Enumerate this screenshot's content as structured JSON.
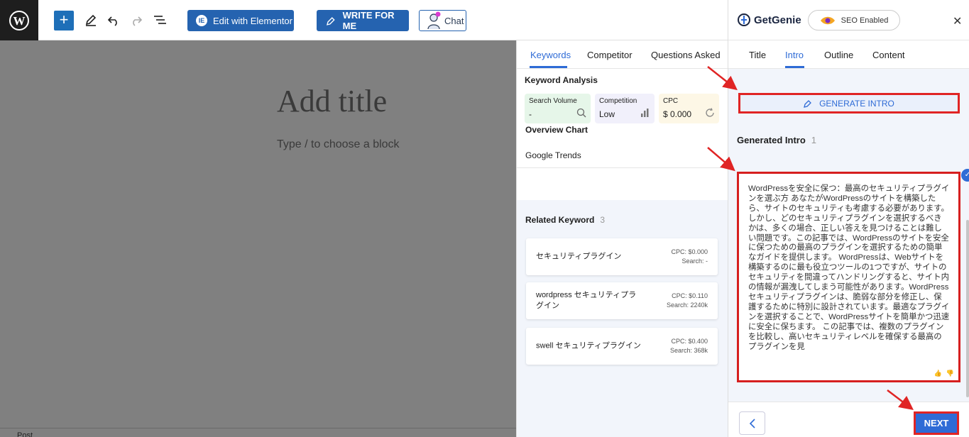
{
  "toolbar": {
    "elementor_label": "Edit with Elementor",
    "write_label": "WRITE FOR ME",
    "chat_label": "Chat"
  },
  "editor": {
    "title_placeholder": "Add title",
    "block_hint": "Type / to choose a block",
    "status": "Post"
  },
  "keyword_panel": {
    "tabs": [
      "Keywords",
      "Competitor",
      "Questions Asked"
    ],
    "active_tab": "Keywords",
    "analysis_title": "Keyword Analysis",
    "metrics": [
      {
        "label": "Search Volume",
        "value": "-",
        "icon": "search-icon",
        "bg": "#e6f6e9"
      },
      {
        "label": "Competition",
        "value": "Low",
        "icon": "bar-chart-icon",
        "bg": "#f1f0fb"
      },
      {
        "label": "CPC",
        "value": "$ 0.000",
        "icon": "dollar-cycle-icon",
        "bg": "#fdf7e6"
      }
    ],
    "overview_chart": "Overview Chart",
    "google_trends": "Google Trends",
    "related_title": "Related Keyword",
    "related_count": "3",
    "related": [
      {
        "keyword": "セキュリティプラグイン",
        "cpc": "CPC: $0.000",
        "search": "Search: -"
      },
      {
        "keyword": "wordpress セキュリティプラグイン",
        "cpc": "CPC: $0.110",
        "search": "Search: 2240k"
      },
      {
        "keyword": "swell セキュリティプラグイン",
        "cpc": "CPC: $0.400",
        "search": "Search: 368k"
      }
    ]
  },
  "genie": {
    "brand": "GetGenie",
    "seo_label": "SEO Enabled",
    "close_icon": "close-icon",
    "tabs": [
      "Title",
      "Intro",
      "Outline",
      "Content"
    ],
    "active_tab": "Intro",
    "generate_label": "GENERATE INTRO",
    "generated_title": "Generated Intro",
    "generated_count": "1",
    "intro_text": "WordPressを安全に保つ：最高のセキュリティプラグインを選ぶ方 あなたがWordPressのサイトを構築したら、サイトのセキュリティも考慮する必要があります。しかし、どのセキュリティプラグインを選択するべきかは、多くの場合、正しい答えを見つけることは難しい問題です。この記事では、WordPressのサイトを安全に保つための最高のプラグインを選択するための簡単なガイドを提供します。 WordPressは、Webサイトを構築するのに最も役立つツールの1つですが、サイトのセキュリティを間違ってハンドリングすると、サイト内の情報が漏洩してしまう可能性があります。WordPressセキュリティプラグインは、脆弱な部分を修正し、保護するために特別に設計されています。最適なプラグインを選択することで、WordPressサイトを簡単かつ迅速に安全に保ちます。 この記事では、複数のプラグインを比較し、高いセキュリティレベルを確保する最高のプラグインを見",
    "next_label": "NEXT"
  },
  "colors": {
    "accent": "#2e6bd6",
    "annotation_red": "#e02424"
  }
}
